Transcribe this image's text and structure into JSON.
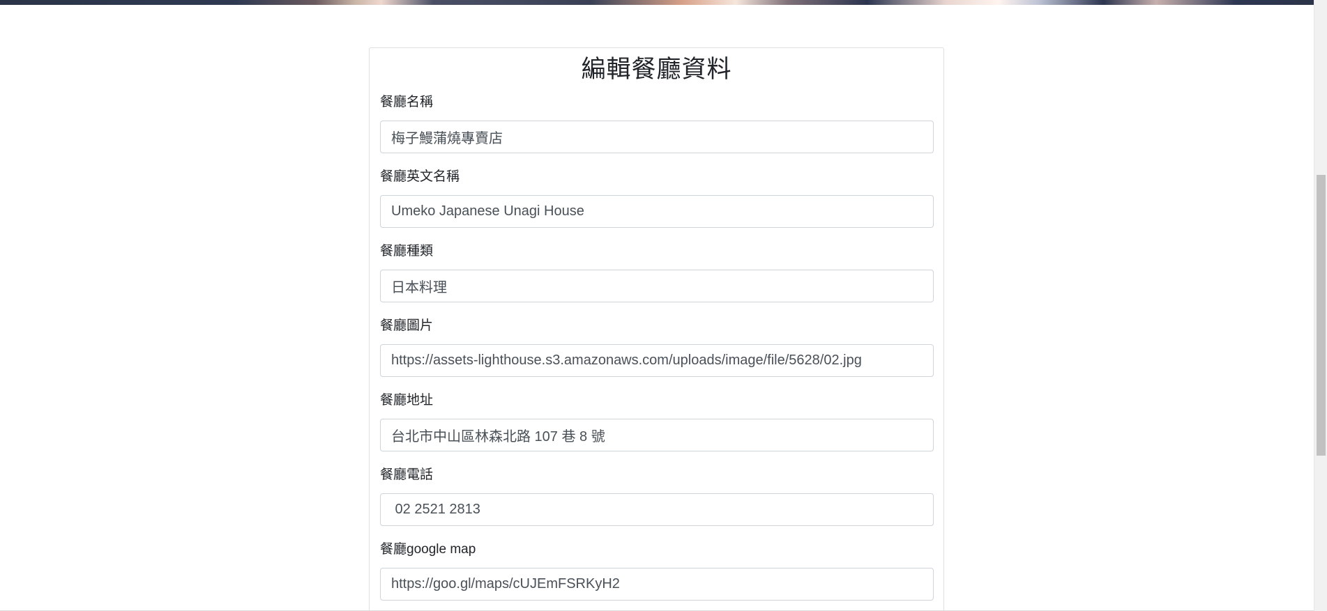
{
  "form": {
    "title": "編輯餐廳資料",
    "fields": [
      {
        "label": "餐廳名稱",
        "value": "梅子鰻蒲燒專賣店"
      },
      {
        "label": "餐廳英文名稱",
        "value": "Umeko Japanese Unagi House"
      },
      {
        "label": "餐廳種類",
        "value": "日本料理"
      },
      {
        "label": "餐廳圖片",
        "value": "https://assets-lighthouse.s3.amazonaws.com/uploads/image/file/5628/02.jpg"
      },
      {
        "label": "餐廳地址",
        "value": "台北市中山區林森北路 107 巷 8 號"
      },
      {
        "label": "餐廳電話",
        "value": " 02 2521 2813"
      },
      {
        "label": "餐廳google map",
        "value": "https://goo.gl/maps/cUJEmFSRKyH2"
      }
    ]
  }
}
